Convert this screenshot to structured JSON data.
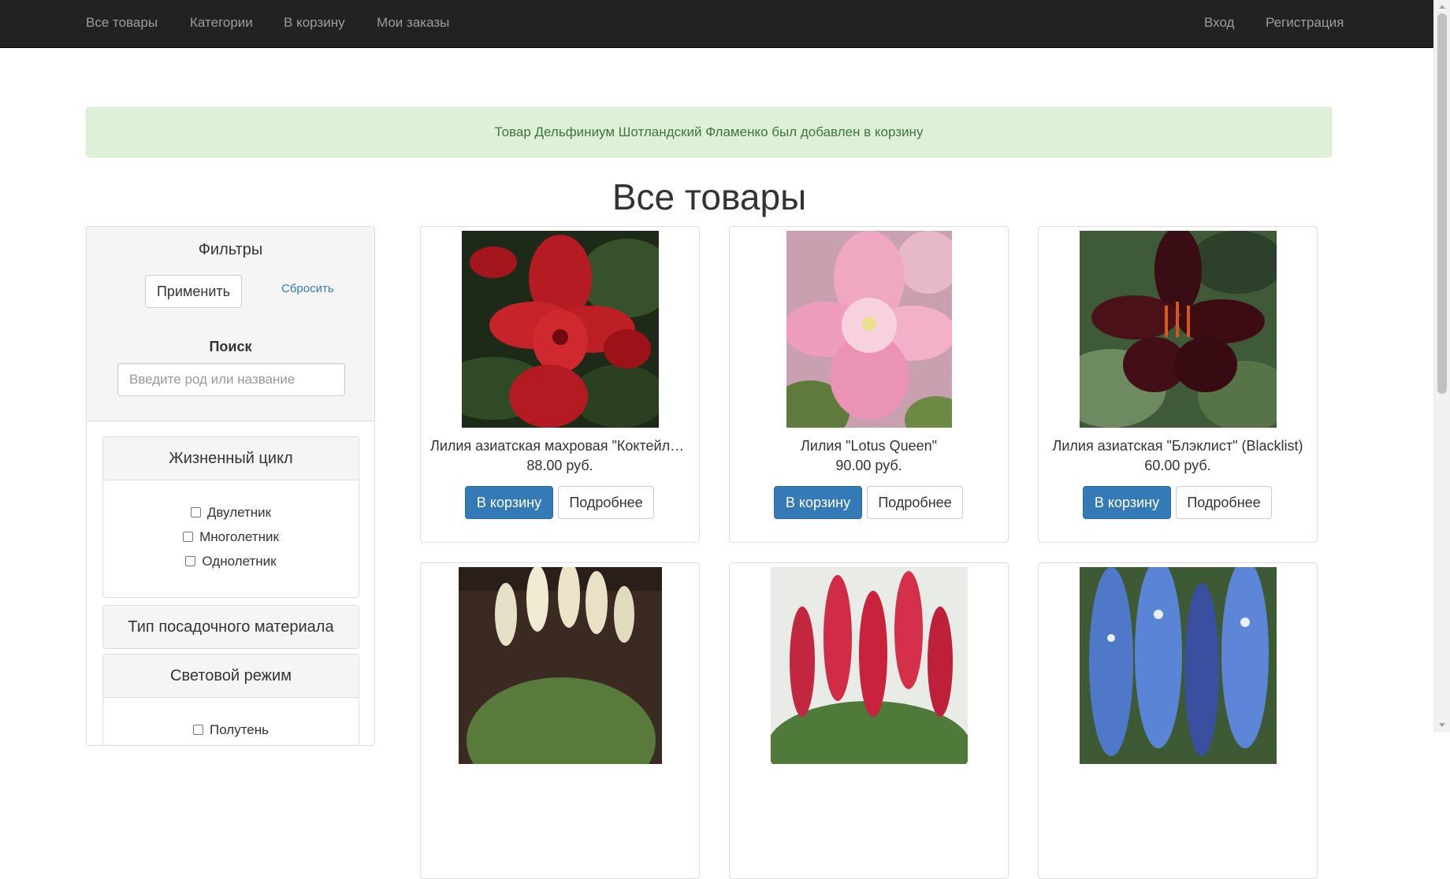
{
  "nav": {
    "left": [
      "Все товары",
      "Категории",
      "В корзину",
      "Мои заказы"
    ],
    "right": [
      "Вход",
      "Регистрация"
    ]
  },
  "alert": {
    "text": "Товар Дельфиниум Шотландский Фламенко был добавлен в корзину"
  },
  "page": {
    "title": "Все товары"
  },
  "filters": {
    "title": "Фильтры",
    "apply_label": "Применить",
    "reset_label": "Сбросить",
    "search_label": "Поиск",
    "search_placeholder": "Введите род или название",
    "lifecycle": {
      "title": "Жизненный цикл",
      "options": [
        "Двулетник",
        "Многолетник",
        "Однолетник"
      ]
    },
    "planting_material": {
      "title": "Тип посадочного материала"
    },
    "light": {
      "title": "Световой режим",
      "options": [
        "Полутень"
      ]
    }
  },
  "buttons": {
    "add_to_cart": "В корзину",
    "details": "Подробнее"
  },
  "products": [
    {
      "name": "Лилия азиатская махровая \"Коктейльная вечеринка\"",
      "price": "88.00 руб.",
      "icon": "red-lily-image"
    },
    {
      "name": "Лилия \"Lotus Queen\"",
      "price": "90.00 руб.",
      "icon": "pink-lily-image"
    },
    {
      "name": "Лилия азиатская \"Блэклист\" (Blacklist)",
      "price": "60.00 руб.",
      "icon": "dark-lily-image"
    },
    {
      "icon": "pampas-grass-image"
    },
    {
      "icon": "red-lupine-image"
    },
    {
      "icon": "blue-delphinium-image"
    }
  ],
  "colors": {
    "navbar_bg": "#222222",
    "nav_text": "#9d9d9d",
    "primary": "#337ab7",
    "alert_bg": "#dff0d8",
    "alert_text": "#3c763d"
  }
}
